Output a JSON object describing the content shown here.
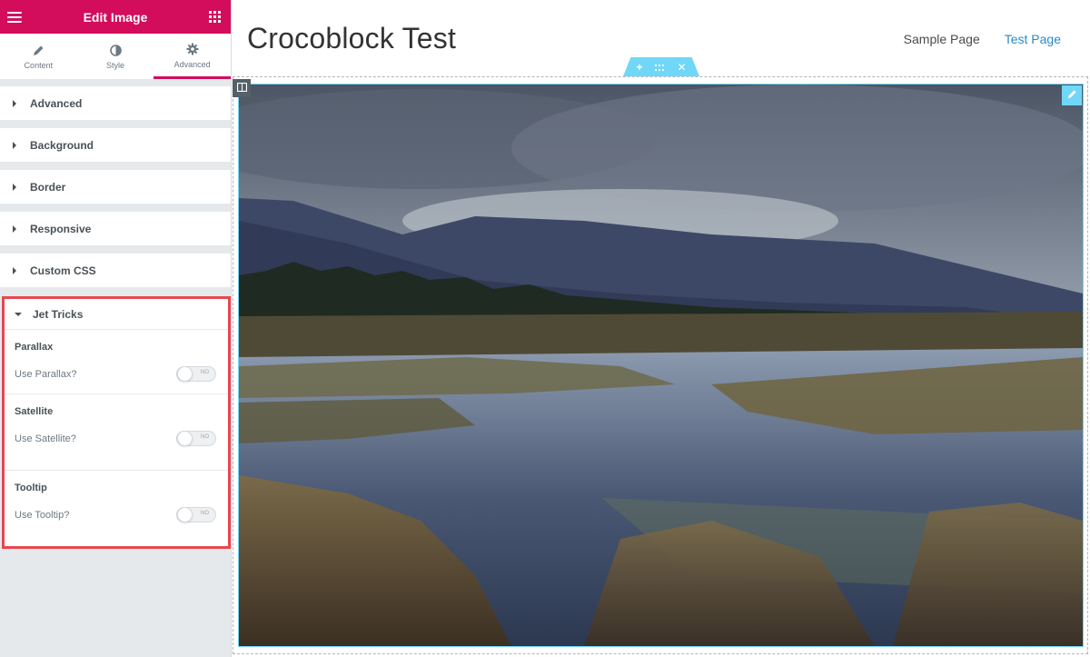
{
  "panel": {
    "title": "Edit Image",
    "tabs": [
      {
        "label": "Content",
        "icon": "pencil-icon"
      },
      {
        "label": "Style",
        "icon": "contrast-icon"
      },
      {
        "label": "Advanced",
        "icon": "gear-icon",
        "active": true
      }
    ],
    "sections": [
      "Advanced",
      "Background",
      "Border",
      "Responsive",
      "Custom CSS"
    ],
    "jet_tricks": {
      "title": "Jet Tricks",
      "groups": [
        {
          "title": "Parallax",
          "control_label": "Use Parallax?",
          "toggle_text": "NO"
        },
        {
          "title": "Satellite",
          "control_label": "Use Satellite?",
          "toggle_text": "NO"
        },
        {
          "title": "Tooltip",
          "control_label": "Use Tooltip?",
          "toggle_text": "NO"
        }
      ]
    },
    "collapse_glyph": "‹"
  },
  "site": {
    "title": "Crocoblock Test",
    "nav": [
      {
        "label": "Sample Page"
      },
      {
        "label": "Test Page",
        "current": true
      }
    ]
  },
  "colors": {
    "brand": "#d30c5c",
    "highlight_border": "#e8474f",
    "editor_handle": "#71d7f7",
    "nav_active": "#2a8ac8"
  }
}
